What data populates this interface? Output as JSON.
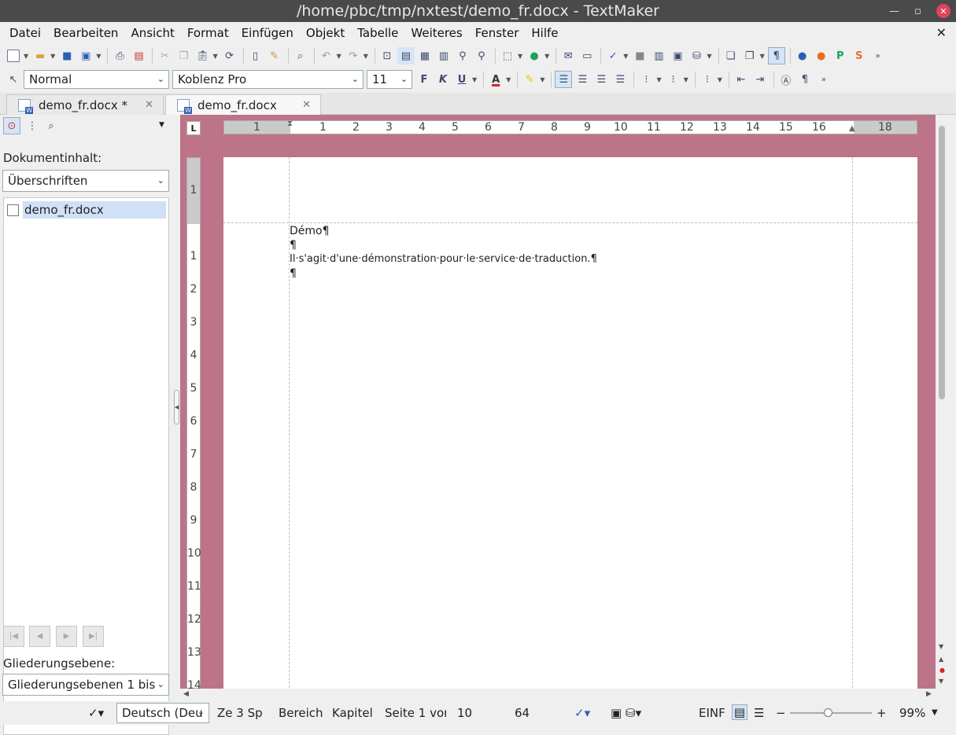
{
  "window": {
    "title": "/home/pbc/tmp/nxtest/demo_fr.docx - TextMaker"
  },
  "menubar": {
    "items": [
      "Datei",
      "Bearbeiten",
      "Ansicht",
      "Format",
      "Einfügen",
      "Objekt",
      "Tabelle",
      "Weiteres",
      "Fenster",
      "Hilfe"
    ]
  },
  "format_toolbar": {
    "style": "Normal",
    "font": "Koblenz Pro",
    "size": "11",
    "bold": "F",
    "italic": "K",
    "underline": "U",
    "font_color": "A"
  },
  "tabs": [
    {
      "label": "demo_fr.docx *",
      "active": false
    },
    {
      "label": "demo_fr.docx",
      "active": true
    }
  ],
  "sidepanel": {
    "content_label": "Dokumentinhalt:",
    "content_select": "Überschriften",
    "tree_item": "demo_fr.docx",
    "level_label": "Gliederungsebene:",
    "level_select": "Gliederungsebenen 1 bis"
  },
  "ruler": {
    "h_numbers": [
      "1",
      "1",
      "2",
      "3",
      "4",
      "5",
      "6",
      "7",
      "8",
      "9",
      "10",
      "11",
      "12",
      "13",
      "14",
      "15",
      "16",
      "18"
    ],
    "v_numbers": [
      "1",
      "1",
      "2",
      "3",
      "4",
      "5",
      "6",
      "7",
      "8",
      "9",
      "10",
      "11",
      "12",
      "13",
      "14"
    ]
  },
  "document": {
    "paragraphs": [
      "Démo¶",
      "¶",
      "Il·s'agit·d'une·démonstration·pour·le·service·de·traduction.¶",
      "¶"
    ]
  },
  "statusbar": {
    "language": "Deutsch (Deu",
    "position": "Ze 3 Sp",
    "section": "Bereich",
    "chapter": "Kapitel",
    "page": "Seite 1 von",
    "line_no": "10",
    "col_no": "64",
    "mode": "EINF",
    "zoom": "99%"
  },
  "colors": {
    "workspace": "#bd7388",
    "titlebar": "#4a4a4a",
    "tree_selection": "#cfe0f7"
  }
}
